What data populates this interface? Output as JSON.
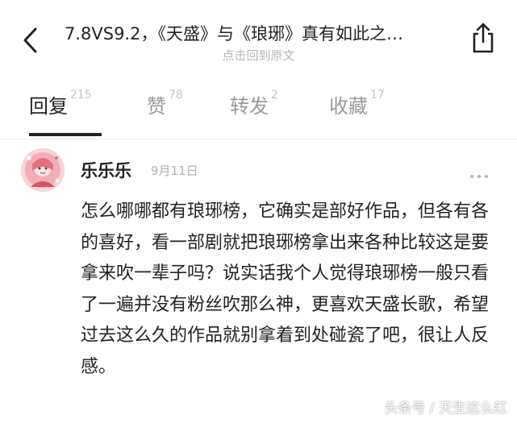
{
  "header": {
    "title": "7.8VS9.2，《天盛》与《琅琊》真有如此之…",
    "subtitle": "点击回到原文",
    "back_icon": "chevron-left-icon",
    "share_icon": "share-icon"
  },
  "tabs": [
    {
      "label": "回复",
      "count": "215",
      "active": true
    },
    {
      "label": "赞",
      "count": "78",
      "active": false
    },
    {
      "label": "转发",
      "count": "2",
      "active": false
    },
    {
      "label": "收藏",
      "count": "17",
      "active": false
    }
  ],
  "comment": {
    "username": "乐乐乐",
    "date": "9月11日",
    "more_icon": "more-dots-icon",
    "body": "怎么哪哪都有琅琊榜，它确实是部好作品，但各有各的喜好，看一部剧就把琅琊榜拿出来各种比较这是要拿来吹一辈子吗？说实话我个人觉得琅琊榜一般只看了一遍并没有粉丝吹那么神，更喜欢天盛长歌，希望过去这么久的作品就别拿着到处碰瓷了吧，很让人反感。"
  },
  "watermark": "头条号 / 天生这么红",
  "colors": {
    "text": "#222222",
    "muted": "#9a9a9a",
    "subtitle": "#b7b7b7",
    "avatar_bg": "#f5c9cf"
  }
}
